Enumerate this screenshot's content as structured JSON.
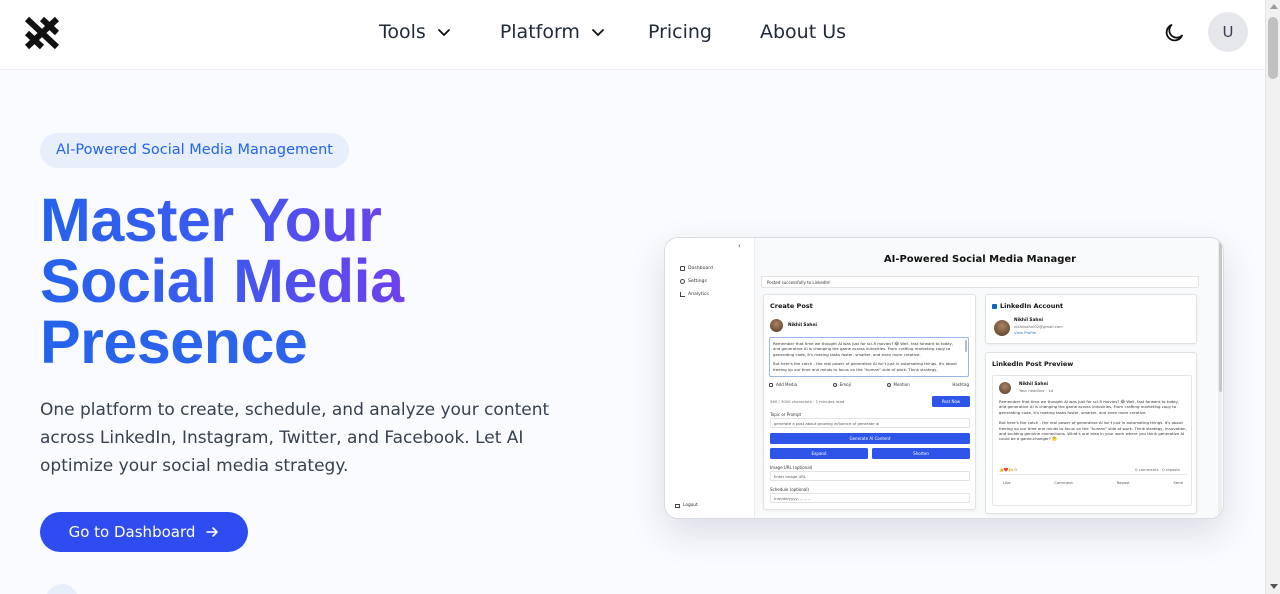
{
  "nav": {
    "links": [
      {
        "label": "Tools"
      },
      {
        "label": "Platform"
      },
      {
        "label": "Pricing"
      },
      {
        "label": "About Us"
      }
    ],
    "avatar_initial": "U",
    "icons": {
      "logo": "x-logo-icon",
      "theme": "moon-icon",
      "dropdown": "chevron-down-icon"
    }
  },
  "hero": {
    "badge": "AI-Powered Social Media Management",
    "title_lines": [
      "Master Your",
      "Social Media",
      "Presence"
    ],
    "description": "One platform to create, schedule, and analyze your content across LinkedIn, Instagram, Twitter, and Facebook. Let AI optimize your social media strategy.",
    "cta_label": "Go to Dashboard",
    "colors": {
      "gradient_start": "#2563eb",
      "gradient_end": "#7c3aed",
      "cta": "#2f4cf0",
      "badge_bg": "#e6effb",
      "badge_text": "#2563eb"
    }
  },
  "mockup": {
    "sidebar": {
      "items": [
        "Dashboard",
        "Settings",
        "Analytics"
      ],
      "logout": "Logout",
      "collapse_glyph": "‹"
    },
    "title": "AI-Powered Social Media Manager",
    "toast": "Posted successfully to LinkedIn!",
    "create_post": {
      "heading": "Create Post",
      "user_name": "Nikhil Sahni",
      "draft_p1": "Remember that time we thought AI was just for sci-fi movies? 😂 Well, fast forward to today, and generative AI is changing the game across industries. From crafting marketing copy to generating code, it's making tasks faster, smarter, and even more creative.",
      "draft_p2": "But here's the catch - the real power of generative AI isn't just in automating things. It's about freeing up our time and minds to focus on the \"human\" side of work. Think strategy,",
      "tools": [
        "Add Media",
        "Emoji",
        "Mention",
        "Hashtag"
      ],
      "counter": "560 / 3000 characters · 1 minutes read",
      "post_now": "Post Now",
      "topic_label": "Topic or Prompt",
      "topic_value": "generate a post about growing influence of generate ai",
      "generate_btn": "Generate AI Content",
      "expand_btn": "Expand",
      "shorten_btn": "Shorten",
      "image_label": "Image URL (optional)",
      "image_placeholder": "Enter Image URL",
      "schedule_label": "Schedule (optional)",
      "schedule_placeholder": "mm/dd/yyyy, -- -- --"
    },
    "linkedin_account": {
      "heading": "LinkedIn Account",
      "name": "Nikhil Sahni",
      "email": "nikhilsahni02@gmail.com",
      "view_profile": "View Profile"
    },
    "preview": {
      "heading": "LinkedIn Post Preview",
      "name": "Nikhil Sahni",
      "subtitle": "Your headline · 1d",
      "p1": "Remember that time we thought AI was just for sci-fi movies? 😂 Well, fast forward to today, and generative AI is changing the game across industries. From crafting marketing copy to generating code, it's making tasks faster, smarter, and even more creative.",
      "p2": "But here's the catch - the real power of generative AI isn't just in automating things. It's about freeing up our time and minds to focus on the \"human\" side of work. Think strategy, innovation, and building genuine connections. What's one area in your work where you think generative AI could be a game-changer? 🤔",
      "reactions": "👍❤️🙌 0",
      "stats": "0 comments · 0 reposts",
      "actions": [
        "Like",
        "Comment",
        "Repost",
        "Send"
      ]
    }
  }
}
